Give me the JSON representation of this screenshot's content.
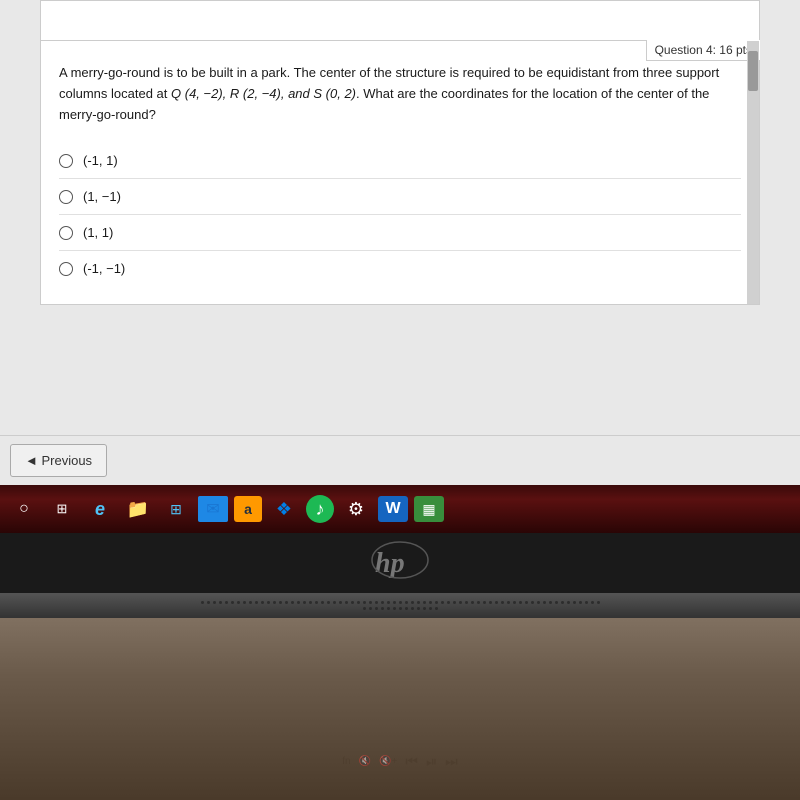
{
  "question": {
    "label": "Question 4: 16 pts",
    "text_part1": "A merry-go-round is to be built in a park. The center of the structure is required to be equidistant from three support columns located at ",
    "text_math": "Q (4, −2), R (2, −4), and S (0, 2)",
    "text_part2": ". What are the coordinates for the location of the center of the merry-go-round?",
    "options": [
      {
        "id": "opt1",
        "label": "(-1, 1)"
      },
      {
        "id": "opt2",
        "label": "(1, −1)"
      },
      {
        "id": "opt3",
        "label": "(1, 1)"
      },
      {
        "id": "opt4",
        "label": "(-1, −1)"
      }
    ]
  },
  "nav": {
    "previous_label": "◄ Previous"
  },
  "taskbar": {
    "icons": [
      {
        "name": "circle-icon",
        "symbol": "○"
      },
      {
        "name": "task-view-icon",
        "symbol": "⊞"
      },
      {
        "name": "edge-icon",
        "symbol": "e"
      },
      {
        "name": "file-explorer-icon",
        "symbol": "📁"
      },
      {
        "name": "windows-store-icon",
        "symbol": "⊞"
      },
      {
        "name": "mail-icon",
        "symbol": "✉"
      },
      {
        "name": "amazon-icon",
        "symbol": "a"
      },
      {
        "name": "dropbox-icon",
        "symbol": "❖"
      },
      {
        "name": "spotify-icon",
        "symbol": "♪"
      },
      {
        "name": "settings-icon",
        "symbol": "⚙"
      },
      {
        "name": "word-icon",
        "symbol": "W"
      },
      {
        "name": "excel-icon",
        "symbol": "▦"
      }
    ]
  },
  "hp": {
    "logo": "hp"
  }
}
